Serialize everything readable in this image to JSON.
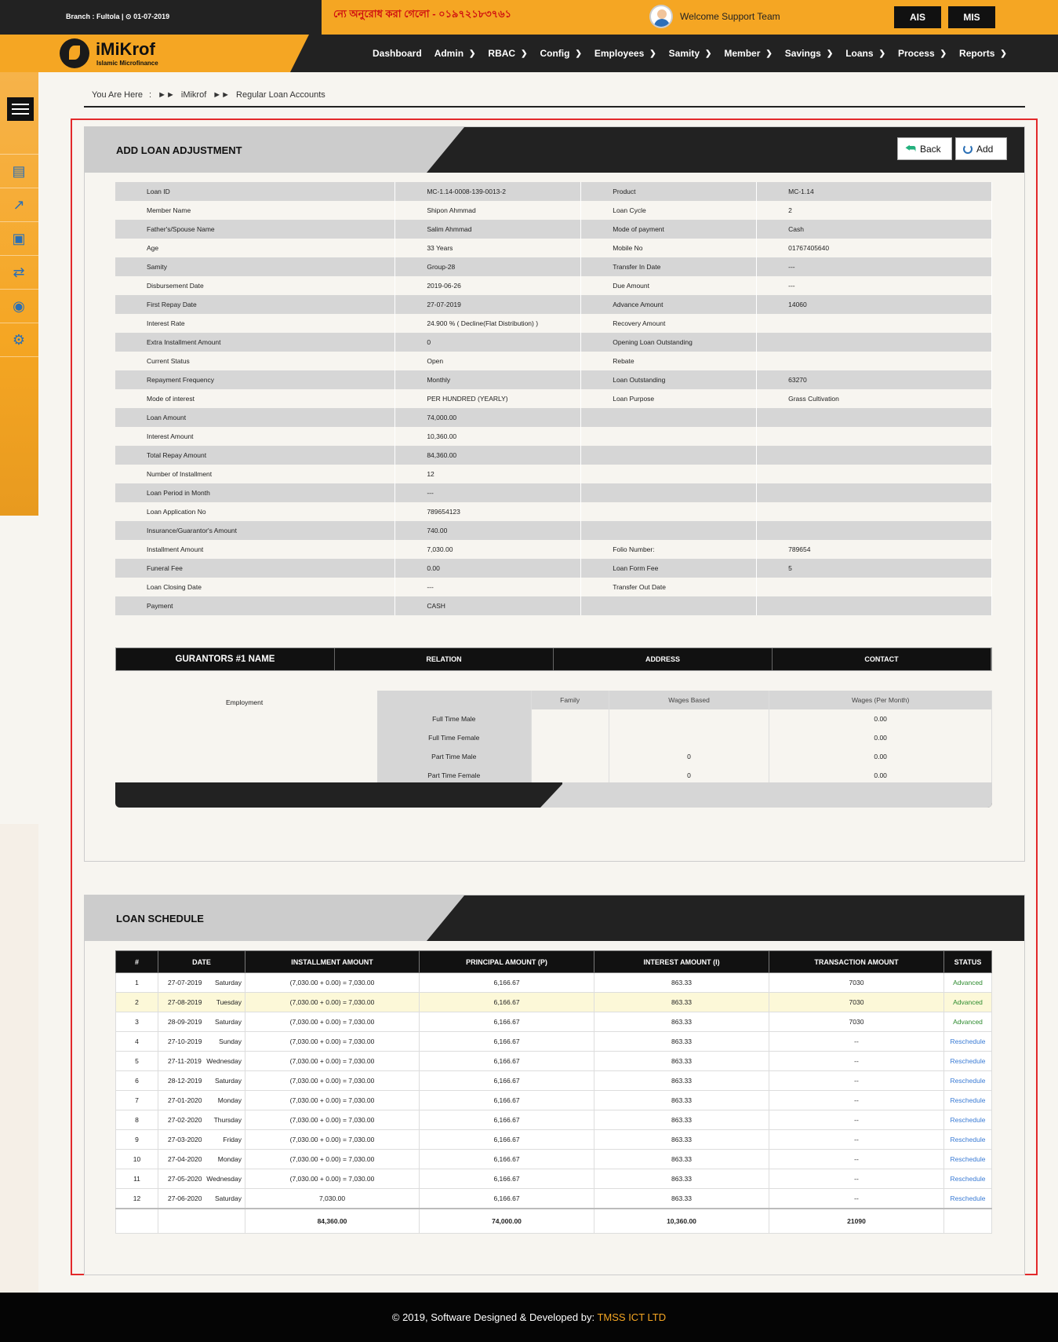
{
  "topbar": {
    "branch": "Branch : Fultola |",
    "date": "01-07-2019",
    "notice": "ন্যে অনুরোধ করা গেলো - ০১৯৭২১৮৩৭৬১",
    "welcome": "Welcome Support Team",
    "btn_ais": "AIS",
    "btn_mis": "MIS"
  },
  "logo": {
    "name": "iMiKrof",
    "tagline": "Islamic Microfinance"
  },
  "nav": [
    "Dashboard",
    "Admin",
    "RBAC",
    "Config",
    "Employees",
    "Samity",
    "Member",
    "Savings",
    "Loans",
    "Process",
    "Reports"
  ],
  "breadcrumb": {
    "prefix": "You Are Here",
    "sep": ":",
    "items": [
      "iMikrof",
      "Regular Loan Accounts"
    ]
  },
  "panel1": {
    "title": "ADD LOAN ADJUSTMENT",
    "back_label": "Back",
    "add_label": "Add",
    "info_rows": [
      [
        "Loan ID",
        "MC-1.14-0008-139-0013-2",
        "Product",
        "MC-1.14"
      ],
      [
        "Member Name",
        "Shipon Ahmmad",
        "Loan Cycle",
        "2"
      ],
      [
        "Father's/Spouse Name",
        "Salim Ahmmad",
        "Mode of payment",
        "Cash"
      ],
      [
        "Age",
        "33 Years",
        "Mobile No",
        "01767405640"
      ],
      [
        "Samity",
        "Group-28",
        "Transfer In Date",
        "---"
      ],
      [
        "Disbursement Date",
        "2019-06-26",
        "Due Amount",
        "---"
      ],
      [
        "First Repay Date",
        "27-07-2019",
        "Advance Amount",
        "14060"
      ],
      [
        "Interest Rate",
        "24.900 % ( Decline(Flat Distribution) )",
        "Recovery Amount",
        ""
      ],
      [
        "Extra Installment Amount",
        "0",
        "Opening Loan Outstanding",
        ""
      ],
      [
        "Current Status",
        "Open",
        "Rebate",
        ""
      ],
      [
        "Repayment Frequency",
        "Monthly",
        "Loan Outstanding",
        "63270"
      ],
      [
        "Mode of interest",
        "PER HUNDRED (YEARLY)",
        "Loan Purpose",
        "Grass Cultivation"
      ],
      [
        "Loan Amount",
        "74,000.00",
        "",
        ""
      ],
      [
        "Interest Amount",
        "10,360.00",
        "",
        ""
      ],
      [
        "Total Repay Amount",
        "84,360.00",
        "",
        ""
      ],
      [
        "Number of Installment",
        "12",
        "",
        ""
      ],
      [
        "Loan Period in Month",
        "---",
        "",
        ""
      ],
      [
        "Loan Application No",
        "789654123",
        "",
        ""
      ],
      [
        "Insurance/Guarantor's Amount",
        "740.00",
        "",
        ""
      ],
      [
        "Installment Amount",
        "7,030.00",
        "Folio Number:",
        "789654"
      ],
      [
        "Funeral Fee",
        "0.00",
        "Loan Form Fee",
        "5"
      ],
      [
        "Loan Closing Date",
        "---",
        "Transfer Out Date",
        ""
      ],
      [
        "Payment",
        "CASH",
        "",
        ""
      ]
    ],
    "guarantor_headers": [
      "GURANTORS #1 NAME",
      "RELATION",
      "ADDRESS",
      "CONTACT"
    ],
    "employment": {
      "label": "Employment",
      "headers": [
        "",
        "Family",
        "Wages Based",
        "Wages (Per Month)"
      ],
      "rows": [
        [
          "Full Time Male",
          "",
          "",
          "0.00"
        ],
        [
          "Full Time Female",
          "",
          "",
          "0.00"
        ],
        [
          "Part Time Male",
          "",
          "0",
          "0.00"
        ],
        [
          "Part Time Female",
          "",
          "0",
          "0.00"
        ]
      ]
    }
  },
  "panel2": {
    "title": "LOAN SCHEDULE",
    "headers": [
      "#",
      "DATE",
      "INSTALLMENT AMOUNT",
      "PRINCIPAL AMOUNT (P)",
      "INTEREST AMOUNT (I)",
      "TRANSACTION AMOUNT",
      "STATUS"
    ],
    "rows": [
      [
        "1",
        "27-07-2019",
        "Saturday",
        "(7,030.00 + 0.00) = 7,030.00",
        "6,166.67",
        "863.33",
        "7030",
        "Advanced"
      ],
      [
        "2",
        "27-08-2019",
        "Tuesday",
        "(7,030.00 + 0.00) = 7,030.00",
        "6,166.67",
        "863.33",
        "7030",
        "Advanced"
      ],
      [
        "3",
        "28-09-2019",
        "Saturday",
        "(7,030.00 + 0.00) = 7,030.00",
        "6,166.67",
        "863.33",
        "7030",
        "Advanced"
      ],
      [
        "4",
        "27-10-2019",
        "Sunday",
        "(7,030.00 + 0.00) = 7,030.00",
        "6,166.67",
        "863.33",
        "--",
        "Reschedule"
      ],
      [
        "5",
        "27-11-2019",
        "Wednesday",
        "(7,030.00 + 0.00) = 7,030.00",
        "6,166.67",
        "863.33",
        "--",
        "Reschedule"
      ],
      [
        "6",
        "28-12-2019",
        "Saturday",
        "(7,030.00 + 0.00) = 7,030.00",
        "6,166.67",
        "863.33",
        "--",
        "Reschedule"
      ],
      [
        "7",
        "27-01-2020",
        "Monday",
        "(7,030.00 + 0.00) = 7,030.00",
        "6,166.67",
        "863.33",
        "--",
        "Reschedule"
      ],
      [
        "8",
        "27-02-2020",
        "Thursday",
        "(7,030.00 + 0.00) = 7,030.00",
        "6,166.67",
        "863.33",
        "--",
        "Reschedule"
      ],
      [
        "9",
        "27-03-2020",
        "Friday",
        "(7,030.00 + 0.00) = 7,030.00",
        "6,166.67",
        "863.33",
        "--",
        "Reschedule"
      ],
      [
        "10",
        "27-04-2020",
        "Monday",
        "(7,030.00 + 0.00) = 7,030.00",
        "6,166.67",
        "863.33",
        "--",
        "Reschedule"
      ],
      [
        "11",
        "27-05-2020",
        "Wednesday",
        "(7,030.00 + 0.00) = 7,030.00",
        "6,166.67",
        "863.33",
        "--",
        "Reschedule"
      ],
      [
        "12",
        "27-06-2020",
        "Saturday",
        "7,030.00",
        "6,166.67",
        "863.33",
        "--",
        "Reschedule"
      ]
    ],
    "totals": [
      "",
      "",
      "84,360.00",
      "74,000.00",
      "10,360.00",
      "21090",
      ""
    ]
  },
  "footer": {
    "text": "© 2019, Software Designed & Developed by:",
    "brand": "TMSS ICT LTD"
  },
  "colors": {
    "accent": "#f5a623",
    "dark": "#222222",
    "advanced": "#2e8b2e",
    "reschedule": "#3a7bd5"
  }
}
